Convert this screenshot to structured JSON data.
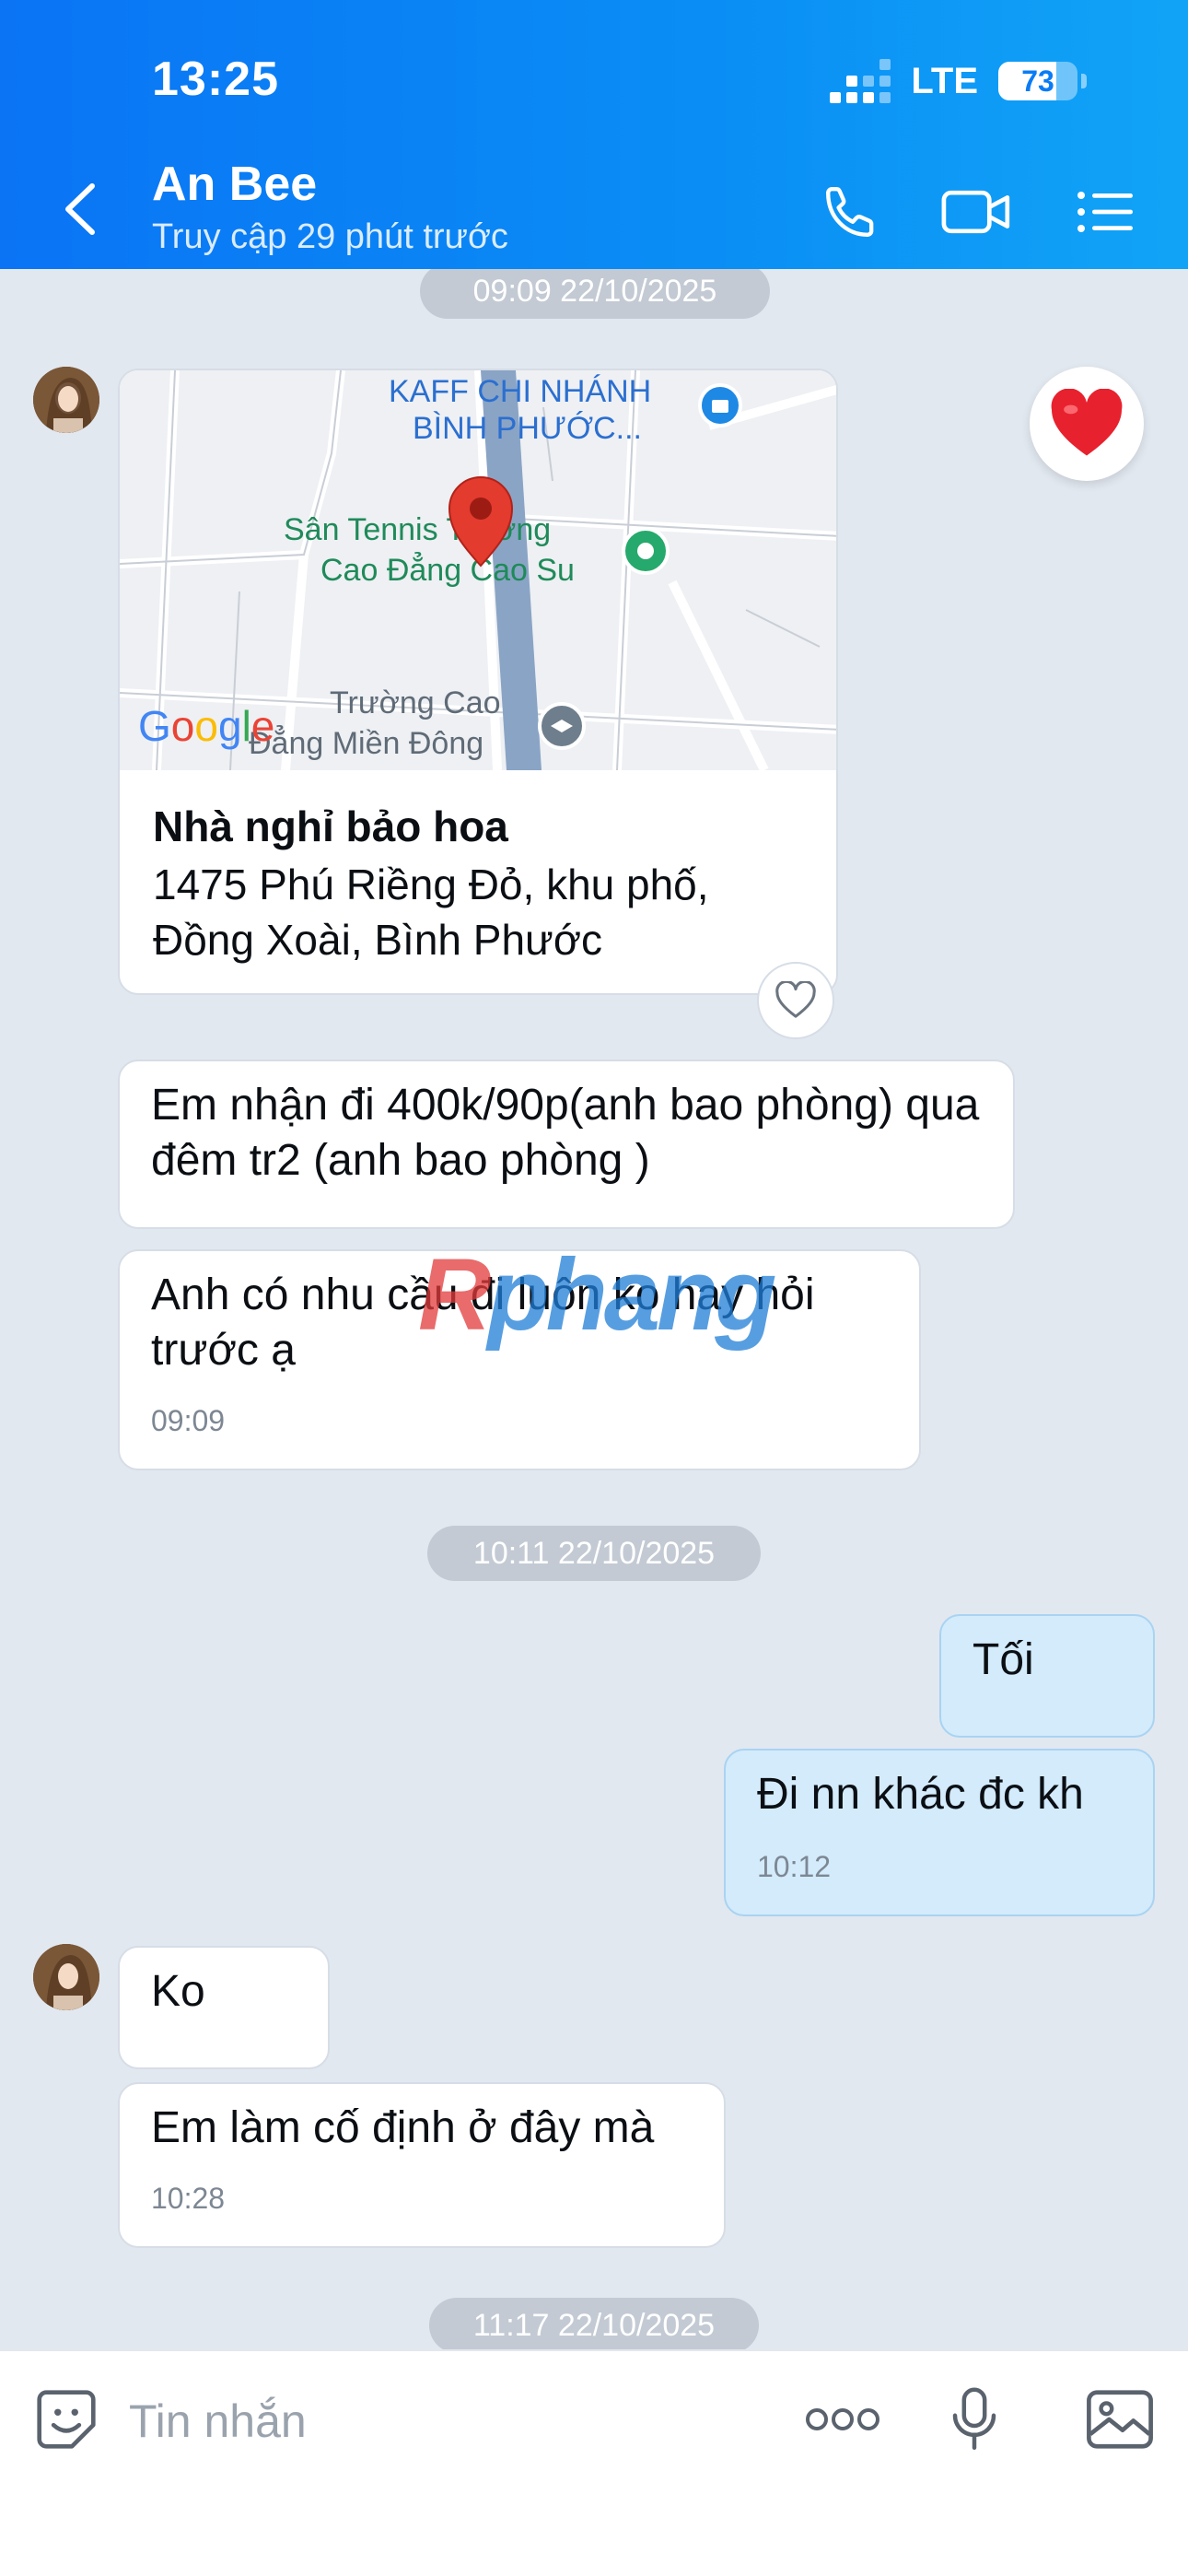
{
  "status_bar": {
    "time": "13:25",
    "network": "LTE",
    "battery": "73",
    "battery_level": 0.73
  },
  "header": {
    "contact_name": "An Bee",
    "last_seen": "Truy cập 29 phút trước",
    "icons": [
      "back-icon",
      "phone-icon",
      "video-call-icon",
      "menu-list-icon"
    ]
  },
  "chat": {
    "timestamps": [
      "09:09 22/10/2025",
      "10:11 22/10/2025",
      "11:17 22/10/2025"
    ],
    "location": {
      "map_labels": {
        "kaff": "KAFF CHI NHÁNH",
        "kaff2": "BÌNH PHƯỚC...",
        "tennis": "Sân Tennis Trường",
        "tennis2": "Cao Đẳng Cao Su",
        "school": "Trường Cao",
        "school2": "Đẳng Miền Đông",
        "google": "Google"
      },
      "place_name": "Nhà nghỉ bảo hoa",
      "address": "1475 Phú Riềng Đỏ, khu phố, Đồng Xoài, Bình Phước"
    },
    "incoming_1": "Em nhận đi 400k/90p(anh bao phòng) qua đêm tr2 (anh bao phòng )",
    "incoming_2": "Anh có nhu cầu đi luôn ko hay hỏi trước ạ",
    "incoming_2_time": "09:09",
    "outgoing_1": "Tối",
    "outgoing_2": "Đi nn khác đc kh",
    "outgoing_2_time": "10:12",
    "incoming_3": "Ko",
    "incoming_4": "Em làm cố định ở đây mà",
    "incoming_4_time": "10:28",
    "watermark_1": "R",
    "watermark_2": "phang"
  },
  "input_bar": {
    "placeholder": "Tin nhắn",
    "icons": [
      "sticker-icon",
      "more-icon",
      "microphone-icon",
      "image-icon"
    ]
  },
  "colors": {
    "header_blue": "#0a74f5",
    "outgoing_bubble": "#d3ebfb",
    "chat_bg": "#e2e8f0",
    "heart_red": "#e8212e"
  }
}
